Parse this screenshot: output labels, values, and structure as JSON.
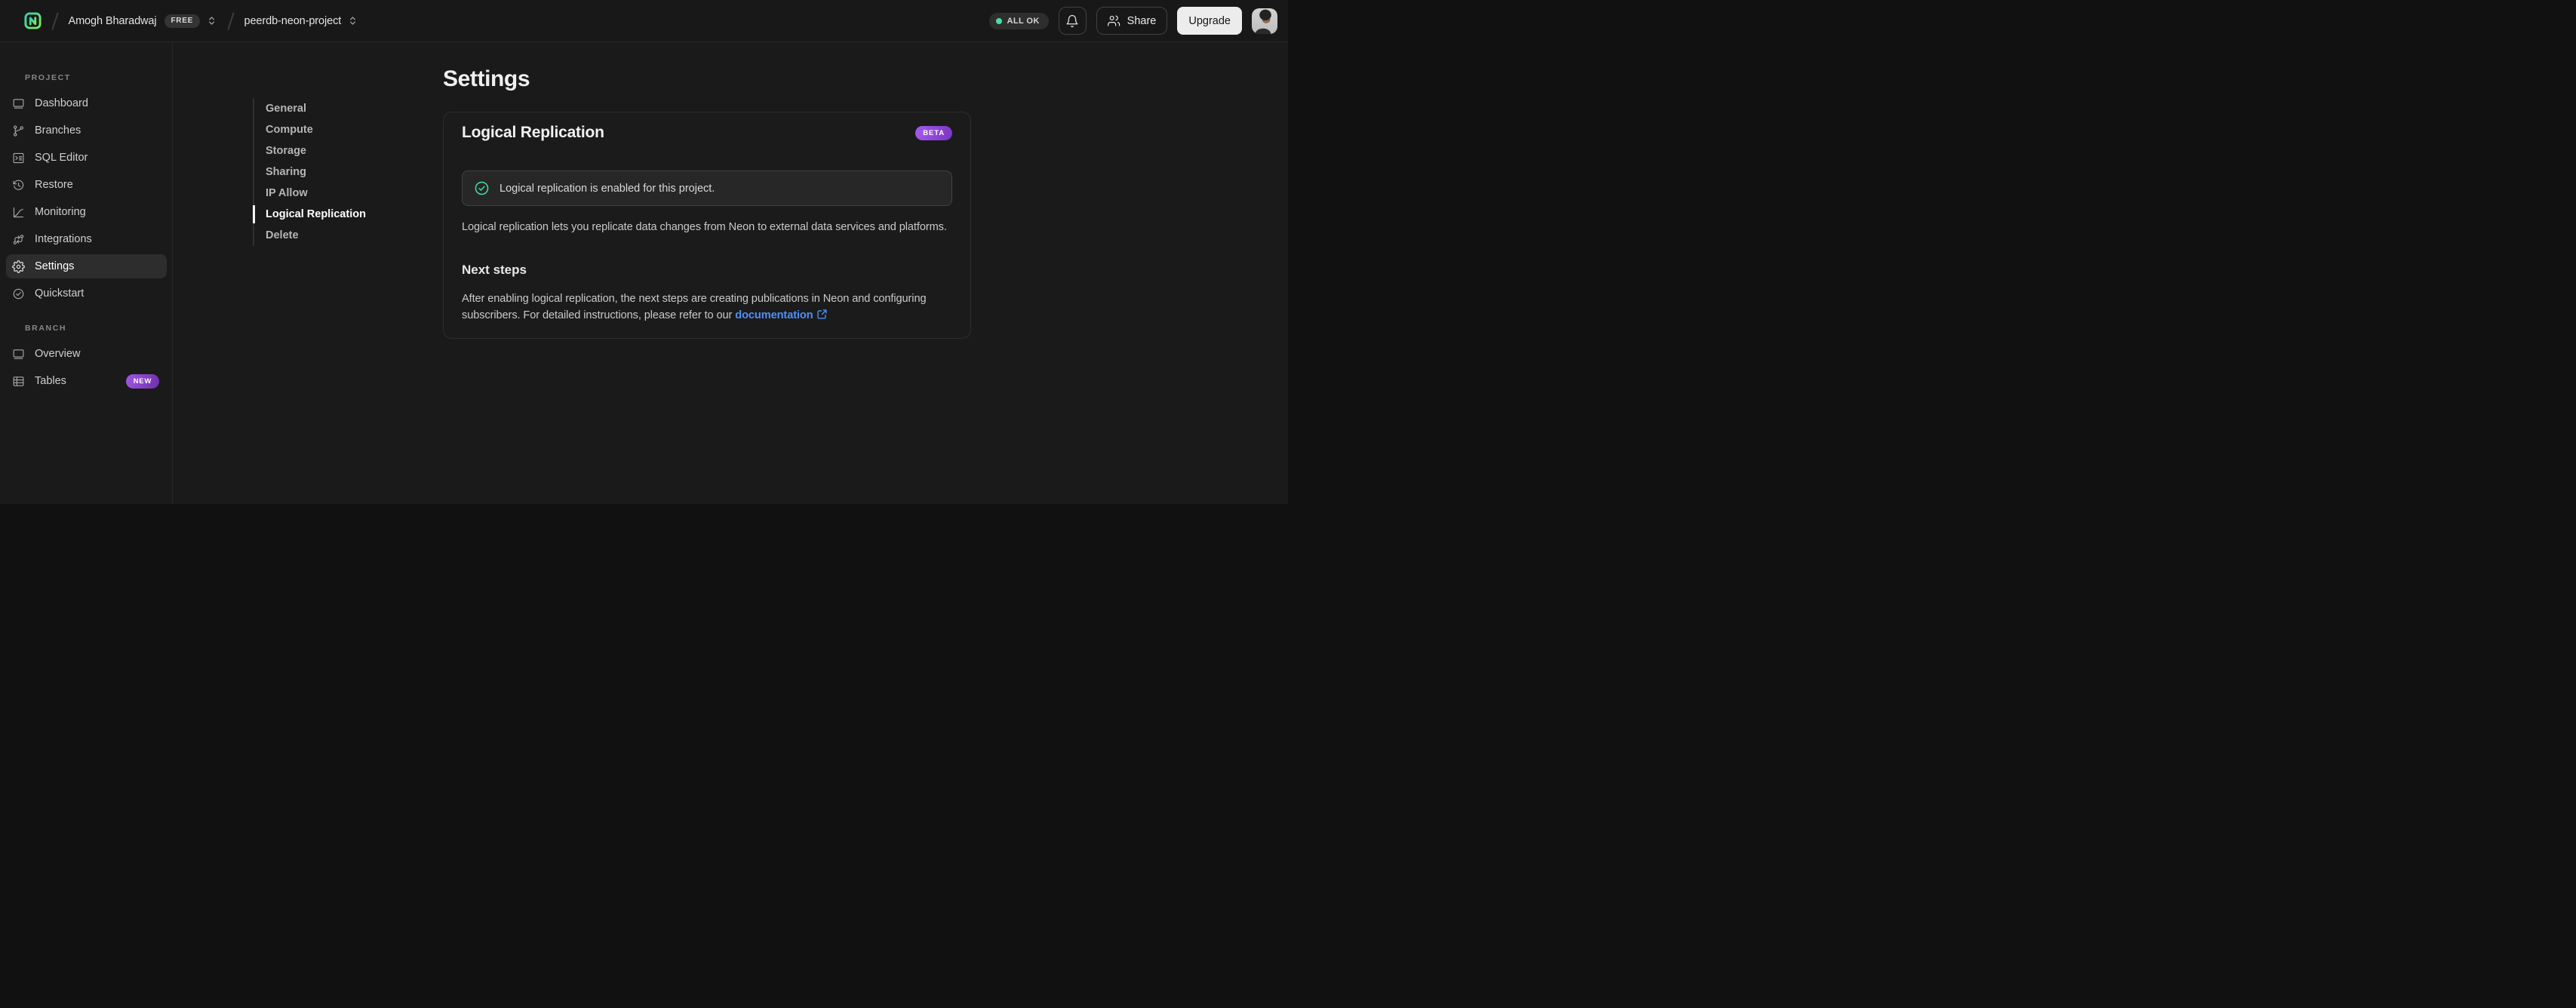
{
  "topbar": {
    "breadcrumb": {
      "org_name": "Amogh Bharadwaj",
      "org_plan_badge": "FREE",
      "project_name": "peerdb-neon-project"
    },
    "status_pill": "ALL OK",
    "share_button": "Share",
    "upgrade_button": "Upgrade"
  },
  "sidebar": {
    "sections": [
      {
        "label": "PROJECT",
        "items": [
          {
            "label": "Dashboard",
            "icon": "window-icon"
          },
          {
            "label": "Branches",
            "icon": "git-branch-icon"
          },
          {
            "label": "SQL Editor",
            "icon": "terminal-icon"
          },
          {
            "label": "Restore",
            "icon": "history-icon"
          },
          {
            "label": "Monitoring",
            "icon": "chart-icon"
          },
          {
            "label": "Integrations",
            "icon": "integrations-icon"
          },
          {
            "label": "Settings",
            "icon": "gear-icon",
            "active": true
          },
          {
            "label": "Quickstart",
            "icon": "check-circle-icon"
          }
        ]
      },
      {
        "label": "BRANCH",
        "items": [
          {
            "label": "Overview",
            "icon": "window-icon"
          },
          {
            "label": "Tables",
            "icon": "table-icon",
            "badge": "NEW"
          }
        ]
      }
    ]
  },
  "settings_nav": {
    "items": [
      {
        "label": "General"
      },
      {
        "label": "Compute"
      },
      {
        "label": "Storage"
      },
      {
        "label": "Sharing"
      },
      {
        "label": "IP Allow"
      },
      {
        "label": "Logical Replication",
        "active": true
      },
      {
        "label": "Delete"
      }
    ]
  },
  "main": {
    "page_title": "Settings",
    "card": {
      "title": "Logical Replication",
      "beta_badge": "BETA",
      "alert_text": "Logical replication is enabled for this project.",
      "description": "Logical replication lets you replicate data changes from Neon to external data services and platforms.",
      "next_steps_heading": "Next steps",
      "next_steps_text": "After enabling logical replication, the next steps are creating publications in Neon and configuring subscribers. For detailed instructions, please refer to our ",
      "doc_link_label": "documentation"
    }
  },
  "colors": {
    "background": "#1a1a1a",
    "card_background": "#1b1b1b",
    "divider": "#282828",
    "accent_green": "#45e0a2",
    "badge_purple": "#8b3fd4",
    "link_blue": "#4f8ff8",
    "upgrade_button_bg": "#ececec"
  }
}
